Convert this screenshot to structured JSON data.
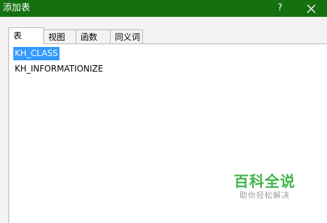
{
  "window": {
    "title": "添加表",
    "help_label": "?",
    "close_icon": "close-icon"
  },
  "tabs": [
    {
      "label": "表",
      "active": true
    },
    {
      "label": "视图",
      "active": false
    },
    {
      "label": "函数",
      "active": false
    },
    {
      "label": "同义词",
      "active": false
    }
  ],
  "tables": [
    {
      "name": "KH_CLASS",
      "selected": true
    },
    {
      "name": "KH_INFORMATIONIZE",
      "selected": false
    }
  ],
  "watermark": {
    "main": "百科全说",
    "sub": "助你轻松解决"
  },
  "colors": {
    "titlebar": "#157010",
    "selection": "#3399ff",
    "watermark": "#3fb54a"
  }
}
